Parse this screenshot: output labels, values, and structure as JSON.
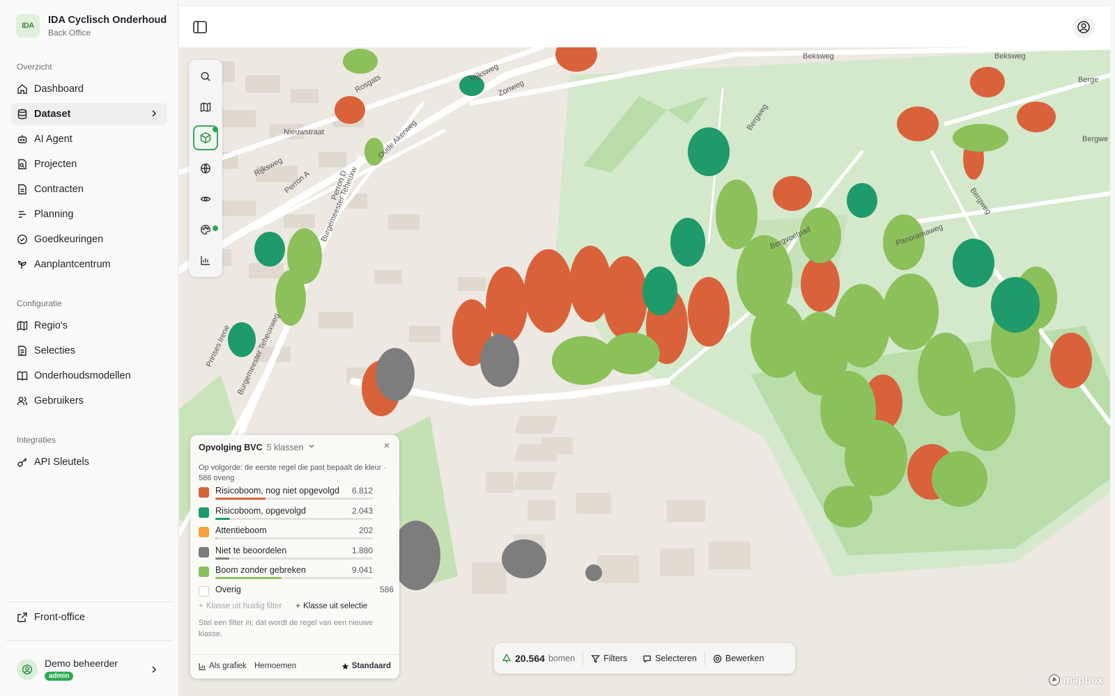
{
  "brand": {
    "logo_text": "IDA",
    "title": "IDA Cyclisch Onderhoud",
    "subtitle": "Back Office"
  },
  "sidebar": {
    "overview_label": "Overzicht",
    "overview_items": [
      {
        "label": "Dashboard",
        "icon": "home-icon"
      },
      {
        "label": "Dataset",
        "icon": "database-icon",
        "active": true
      },
      {
        "label": "AI Agent",
        "icon": "bot-icon"
      },
      {
        "label": "Projecten",
        "icon": "folder-icon"
      },
      {
        "label": "Contracten",
        "icon": "document-icon"
      },
      {
        "label": "Planning",
        "icon": "list-icon"
      },
      {
        "label": "Goedkeuringen",
        "icon": "check-circle-icon"
      },
      {
        "label": "Aanplantcentrum",
        "icon": "sprout-icon"
      }
    ],
    "config_label": "Configuratie",
    "config_items": [
      {
        "label": "Regio's",
        "icon": "map-icon"
      },
      {
        "label": "Selecties",
        "icon": "selection-icon"
      },
      {
        "label": "Onderhoudsmodellen",
        "icon": "book-icon"
      },
      {
        "label": "Gebruikers",
        "icon": "users-icon"
      }
    ],
    "integrations_label": "Integraties",
    "integration_items": [
      {
        "label": "API Sleutels",
        "icon": "key-icon"
      }
    ],
    "front_office": "Front-office",
    "user": {
      "name": "Demo beheerder",
      "role": "admin"
    }
  },
  "map": {
    "street_labels": [
      "Beksweg",
      "Beksweg",
      "Rijksweg",
      "Zonweg",
      "Nieuwstraat",
      "Oude Akerweg",
      "Rijksweg",
      "Perron A",
      "Perron D",
      "Burgemeester Teheuxw",
      "Burgemeester Teheuxweg",
      "Rosgats",
      "Bergweg",
      "Bergweg",
      "Panoramaweg",
      "Bergvoetpad",
      "Berge",
      "Bergwe",
      "Prinses Irene"
    ],
    "toolbar": [
      "search-icon",
      "map-icon",
      "cube-icon",
      "globe-icon",
      "eye-icon",
      "palette-icon",
      "chart-icon"
    ],
    "attribution": "mapbox"
  },
  "legend": {
    "title": "Opvolging BVC",
    "class_count": "5 klassen",
    "description": "Op volgorde: de eerste regel die past bepaalt de kleur · 586 overig",
    "classes": [
      {
        "label": "Risicoboom, nog niet opgevolgd",
        "value": "6.812",
        "count": 6812,
        "color": "#d9623a"
      },
      {
        "label": "Risicoboom, opgevolgd",
        "value": "2.043",
        "count": 2043,
        "color": "#1f9a6a"
      },
      {
        "label": "Attentieboom",
        "value": "202",
        "count": 202,
        "color": "#f2a23a"
      },
      {
        "label": "Niet te beoordelen",
        "value": "1.880",
        "count": 1880,
        "color": "#7d7d7d"
      },
      {
        "label": "Boom zonder gebreken",
        "value": "9.041",
        "count": 9041,
        "color": "#8cc05a"
      }
    ],
    "other": {
      "label": "Overig",
      "value": "586"
    },
    "add_from_filter": "Klasse uit huidig filter",
    "add_from_selection": "Klasse uit selectie",
    "hint": "Stel een filter in; dat wordt de regel van een nieuwe klasse.",
    "as_chart": "Als grafiek",
    "rename": "Hernoemen",
    "default": "Standaard"
  },
  "bottom_bar": {
    "count": "20.564",
    "unit": "bomen",
    "filters": "Filters",
    "select": "Selecteren",
    "edit": "Bewerken"
  },
  "colors": {
    "accent": "#2fa84f",
    "risk_open": "#d9623a",
    "risk_done": "#1f9a6a",
    "healthy": "#8cc05a"
  }
}
